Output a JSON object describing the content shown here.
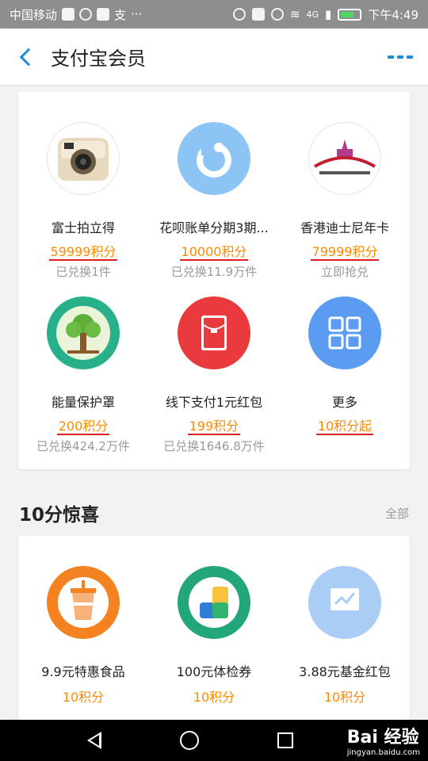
{
  "status_bar": {
    "carrier": "中国移动",
    "app_char": "支",
    "dots": "···",
    "network": "4G",
    "time": "下午4:49"
  },
  "header": {
    "title": "支付宝会员"
  },
  "rewards": [
    {
      "name": "富士拍立得",
      "price": "59999积分",
      "sub": "已兑换1件",
      "icon": "instax-camera-icon"
    },
    {
      "name": "花呗账单分期3期...",
      "price": "10000积分",
      "sub": "已兑换11.9万件",
      "icon": "huabei-icon"
    },
    {
      "name": "香港迪士尼年卡",
      "price": "79999积分",
      "sub": "立即抢兑",
      "icon": "disneyland-logo-icon"
    },
    {
      "name": "能量保护罩",
      "price": "200积分",
      "sub": "已兑换424.2万件",
      "icon": "tree-icon"
    },
    {
      "name": "线下支付1元红包",
      "price": "199积分",
      "sub": "已兑换1646.8万件",
      "icon": "red-envelope-icon"
    },
    {
      "name": "更多",
      "price": "10积分起",
      "sub": "",
      "icon": "grid-icon"
    }
  ],
  "section": {
    "title": "10分惊喜",
    "all_label": "全部"
  },
  "surprises": [
    {
      "name": "9.9元特惠食品",
      "price": "10积分",
      "icon": "drink-cup-icon"
    },
    {
      "name": "100元体检券",
      "price": "10积分",
      "icon": "health-check-icon"
    },
    {
      "name": "3.88元基金红包",
      "price": "10积分",
      "icon": "fund-chart-icon"
    }
  ],
  "watermark": {
    "brand": "Bai 经验",
    "url": "jingyan.baidu.com"
  },
  "colors": {
    "accent": "#1a8cd8",
    "price": "#ff8a00",
    "underline": "#e02020"
  }
}
